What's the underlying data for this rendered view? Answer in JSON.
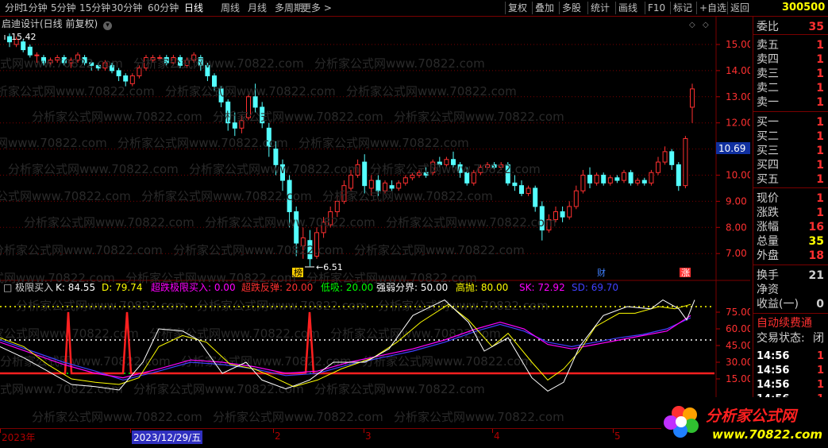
{
  "toolbar": {
    "left_items": [
      "分时",
      "1分钟",
      "5分钟",
      "15分钟",
      "30分钟",
      "60分钟",
      "日线",
      "周线",
      "月线",
      "多周期",
      "更多 >"
    ],
    "active": "日线",
    "right_items": [
      "复权",
      "叠加",
      "多股",
      "统计",
      "画线",
      "F10",
      "标记",
      "+自选",
      "返回"
    ],
    "code": "300500"
  },
  "chart": {
    "title": "启迪设计(日线 前复权)",
    "y_labels": [
      "15.00",
      "14.00",
      "13.00",
      "12.00",
      "11.00",
      "10.00",
      "9.00",
      "8.00",
      "7.00"
    ],
    "current_price_tag": "10.69",
    "high_label": "15.42",
    "low_label": "6.51",
    "markers": [
      "榜",
      "财",
      "涨"
    ],
    "indicator_title": "极限买入",
    "indicator_values": [
      {
        "label": "K: 84.55",
        "color": "#ffffff"
      },
      {
        "label": "D: 79.74",
        "color": "#ffff00"
      },
      {
        "label": "超跌极限买入: 0.00",
        "color": "#ff00ff"
      },
      {
        "label": "超跌反弹: 20.00",
        "color": "#ff3030"
      },
      {
        "label": "低吸: 20.00",
        "color": "#00ff00"
      },
      {
        "label": "强弱分界: 50.00",
        "color": "#ffffff"
      },
      {
        "label": "高抛: 80.00",
        "color": "#ffff00"
      },
      {
        "label": "SK: 72.92",
        "color": "#ff00ff"
      },
      {
        "label": "SD: 69.70",
        "color": "#4040ff"
      }
    ],
    "ind_y_labels": [
      "75.00",
      "60.00",
      "45.00",
      "30.00",
      "15.00"
    ],
    "dates": [
      "2023年",
      "2023/12/29/五",
      "2",
      "3",
      "4",
      "5"
    ]
  },
  "side": {
    "rows": [
      {
        "label": "委比",
        "value": "35",
        "color": "#ff3030"
      },
      {
        "label": "卖五",
        "value": "1",
        "color": "#ff3030"
      },
      {
        "label": "卖四",
        "value": "1",
        "color": "#ff3030"
      },
      {
        "label": "卖三",
        "value": "1",
        "color": "#ff3030"
      },
      {
        "label": "卖二",
        "value": "1",
        "color": "#ff3030"
      },
      {
        "label": "卖一",
        "value": "1",
        "color": "#ff3030"
      },
      {
        "label": "买一",
        "value": "1",
        "color": "#ff3030"
      },
      {
        "label": "买二",
        "value": "1",
        "color": "#ff3030"
      },
      {
        "label": "买三",
        "value": "1",
        "color": "#ff3030"
      },
      {
        "label": "买四",
        "value": "1",
        "color": "#ff3030"
      },
      {
        "label": "买五",
        "value": "1",
        "color": "#ff3030"
      },
      {
        "label": "现价",
        "value": "1",
        "color": "#ff3030"
      },
      {
        "label": "涨跌",
        "value": "1",
        "color": "#ff3030"
      },
      {
        "label": "涨幅",
        "value": "16",
        "color": "#ff3030"
      },
      {
        "label": "总量",
        "value": "35",
        "color": "#ffff00"
      },
      {
        "label": "外盘",
        "value": "18",
        "color": "#ff3030"
      },
      {
        "label": "换手",
        "value": "21",
        "color": "#d0d0d0"
      },
      {
        "label": "净资",
        "value": "",
        "color": "#d0d0d0"
      },
      {
        "label": "收益(一)",
        "value": "0",
        "color": "#d0d0d0"
      }
    ],
    "auto_text": "自动续费通",
    "trade_state": "交易状态:",
    "trade_state_value": "闭",
    "ticks": [
      {
        "time": "14:56",
        "value": "1"
      },
      {
        "time": "14:56",
        "value": "1"
      },
      {
        "time": "14:56",
        "value": "1"
      },
      {
        "time": "14:56",
        "value": "1"
      }
    ]
  },
  "watermark": {
    "text": "分析家公式网www.70822.com",
    "logo_top": "分析家公式网",
    "logo_bottom": "www.70822.com"
  }
}
